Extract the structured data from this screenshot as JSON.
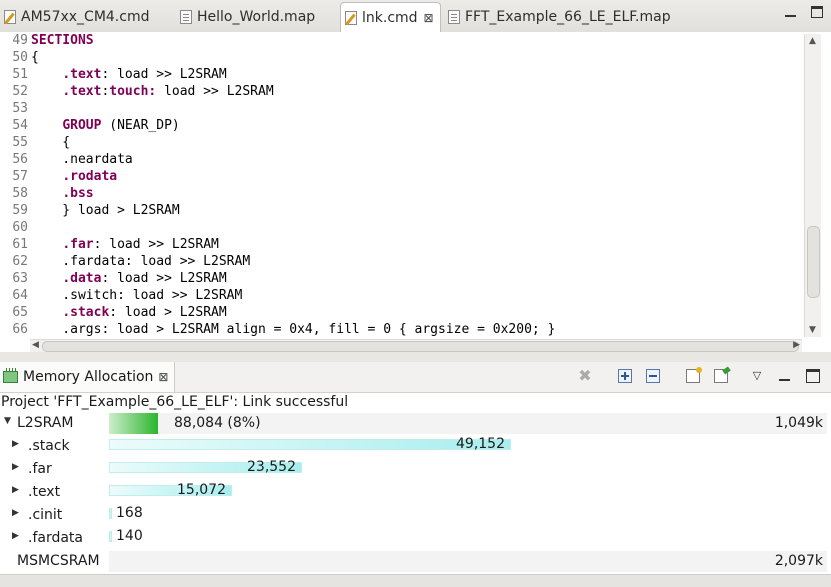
{
  "editor_tabs": [
    {
      "label": "AM57xx_CM4.cmd",
      "icon": "pencil-file-icon",
      "active": false
    },
    {
      "label": "Hello_World.map",
      "icon": "file-icon",
      "active": false
    },
    {
      "label": "lnk.cmd",
      "icon": "pencil-file-icon",
      "active": true,
      "close": "⊠"
    },
    {
      "label": "FFT_Example_66_LE_ELF.map",
      "icon": "file-icon",
      "active": false
    }
  ],
  "code_lines": [
    {
      "num": "49",
      "segments": [
        {
          "t": "SECTIONS",
          "k": true
        }
      ]
    },
    {
      "num": "50",
      "segments": [
        {
          "t": "{",
          "k": false
        }
      ]
    },
    {
      "num": "51",
      "segments": [
        {
          "t": "    ",
          "k": false
        },
        {
          "t": ".text",
          "k": true
        },
        {
          "t": ": load >> L2SRAM",
          "k": false
        }
      ]
    },
    {
      "num": "52",
      "segments": [
        {
          "t": "    ",
          "k": false
        },
        {
          "t": ".text",
          "k": true
        },
        {
          "t": ":",
          "k": false
        },
        {
          "t": "touch:",
          "k": true
        },
        {
          "t": " load >> L2SRAM",
          "k": false
        }
      ]
    },
    {
      "num": "53",
      "segments": []
    },
    {
      "num": "54",
      "segments": [
        {
          "t": "    ",
          "k": false
        },
        {
          "t": "GROUP",
          "k": true
        },
        {
          "t": " (NEAR_DP)",
          "k": false
        }
      ]
    },
    {
      "num": "55",
      "segments": [
        {
          "t": "    {",
          "k": false
        }
      ]
    },
    {
      "num": "56",
      "segments": [
        {
          "t": "    .neardata",
          "k": false
        }
      ]
    },
    {
      "num": "57",
      "segments": [
        {
          "t": "    ",
          "k": false
        },
        {
          "t": ".rodata",
          "k": true
        }
      ]
    },
    {
      "num": "58",
      "segments": [
        {
          "t": "    ",
          "k": false
        },
        {
          "t": ".bss",
          "k": true
        }
      ]
    },
    {
      "num": "59",
      "segments": [
        {
          "t": "    } load > L2SRAM",
          "k": false
        }
      ]
    },
    {
      "num": "60",
      "segments": []
    },
    {
      "num": "61",
      "segments": [
        {
          "t": "    ",
          "k": false
        },
        {
          "t": ".far",
          "k": true
        },
        {
          "t": ": load >> L2SRAM",
          "k": false
        }
      ]
    },
    {
      "num": "62",
      "segments": [
        {
          "t": "    .fardata: load >> L2SRAM",
          "k": false
        }
      ]
    },
    {
      "num": "63",
      "segments": [
        {
          "t": "    ",
          "k": false
        },
        {
          "t": ".data",
          "k": true
        },
        {
          "t": ": load >> L2SRAM",
          "k": false
        }
      ]
    },
    {
      "num": "64",
      "segments": [
        {
          "t": "    .switch: load >> L2SRAM",
          "k": false
        }
      ]
    },
    {
      "num": "65",
      "segments": [
        {
          "t": "    ",
          "k": false
        },
        {
          "t": ".stack",
          "k": true
        },
        {
          "t": ": load > L2SRAM",
          "k": false
        }
      ]
    },
    {
      "num": "66",
      "segments": [
        {
          "t": "    .args: load > L2SRAM align = 0x4, fill = 0 { argsize = 0x200; }",
          "k": false
        }
      ]
    }
  ],
  "memory_view": {
    "title": "Memory Allocation",
    "close_glyph": "⊠",
    "status": "Project 'FFT_Example_66_LE_ELF': Link successful",
    "regions": [
      {
        "name": "L2SRAM",
        "expanded": true,
        "used_label": "88,084 (8%)",
        "used_fraction": 0.084,
        "capacity_label": "1,049k",
        "sections": [
          {
            "name": ".stack",
            "value": 49152,
            "value_label": "49,152"
          },
          {
            "name": ".far",
            "value": 23552,
            "value_label": "23,552"
          },
          {
            "name": ".text",
            "value": 15072,
            "value_label": "15,072"
          },
          {
            "name": ".cinit",
            "value": 168,
            "value_label": "168"
          },
          {
            "name": ".fardata",
            "value": 140,
            "value_label": "140"
          }
        ]
      },
      {
        "name": "MSMCSRAM",
        "expanded": false,
        "capacity_label": "2,097k"
      }
    ]
  },
  "colors": {
    "keyword": "#7f0055",
    "used_bar": "#2bb52b",
    "section_bar": "#a7eeee"
  }
}
